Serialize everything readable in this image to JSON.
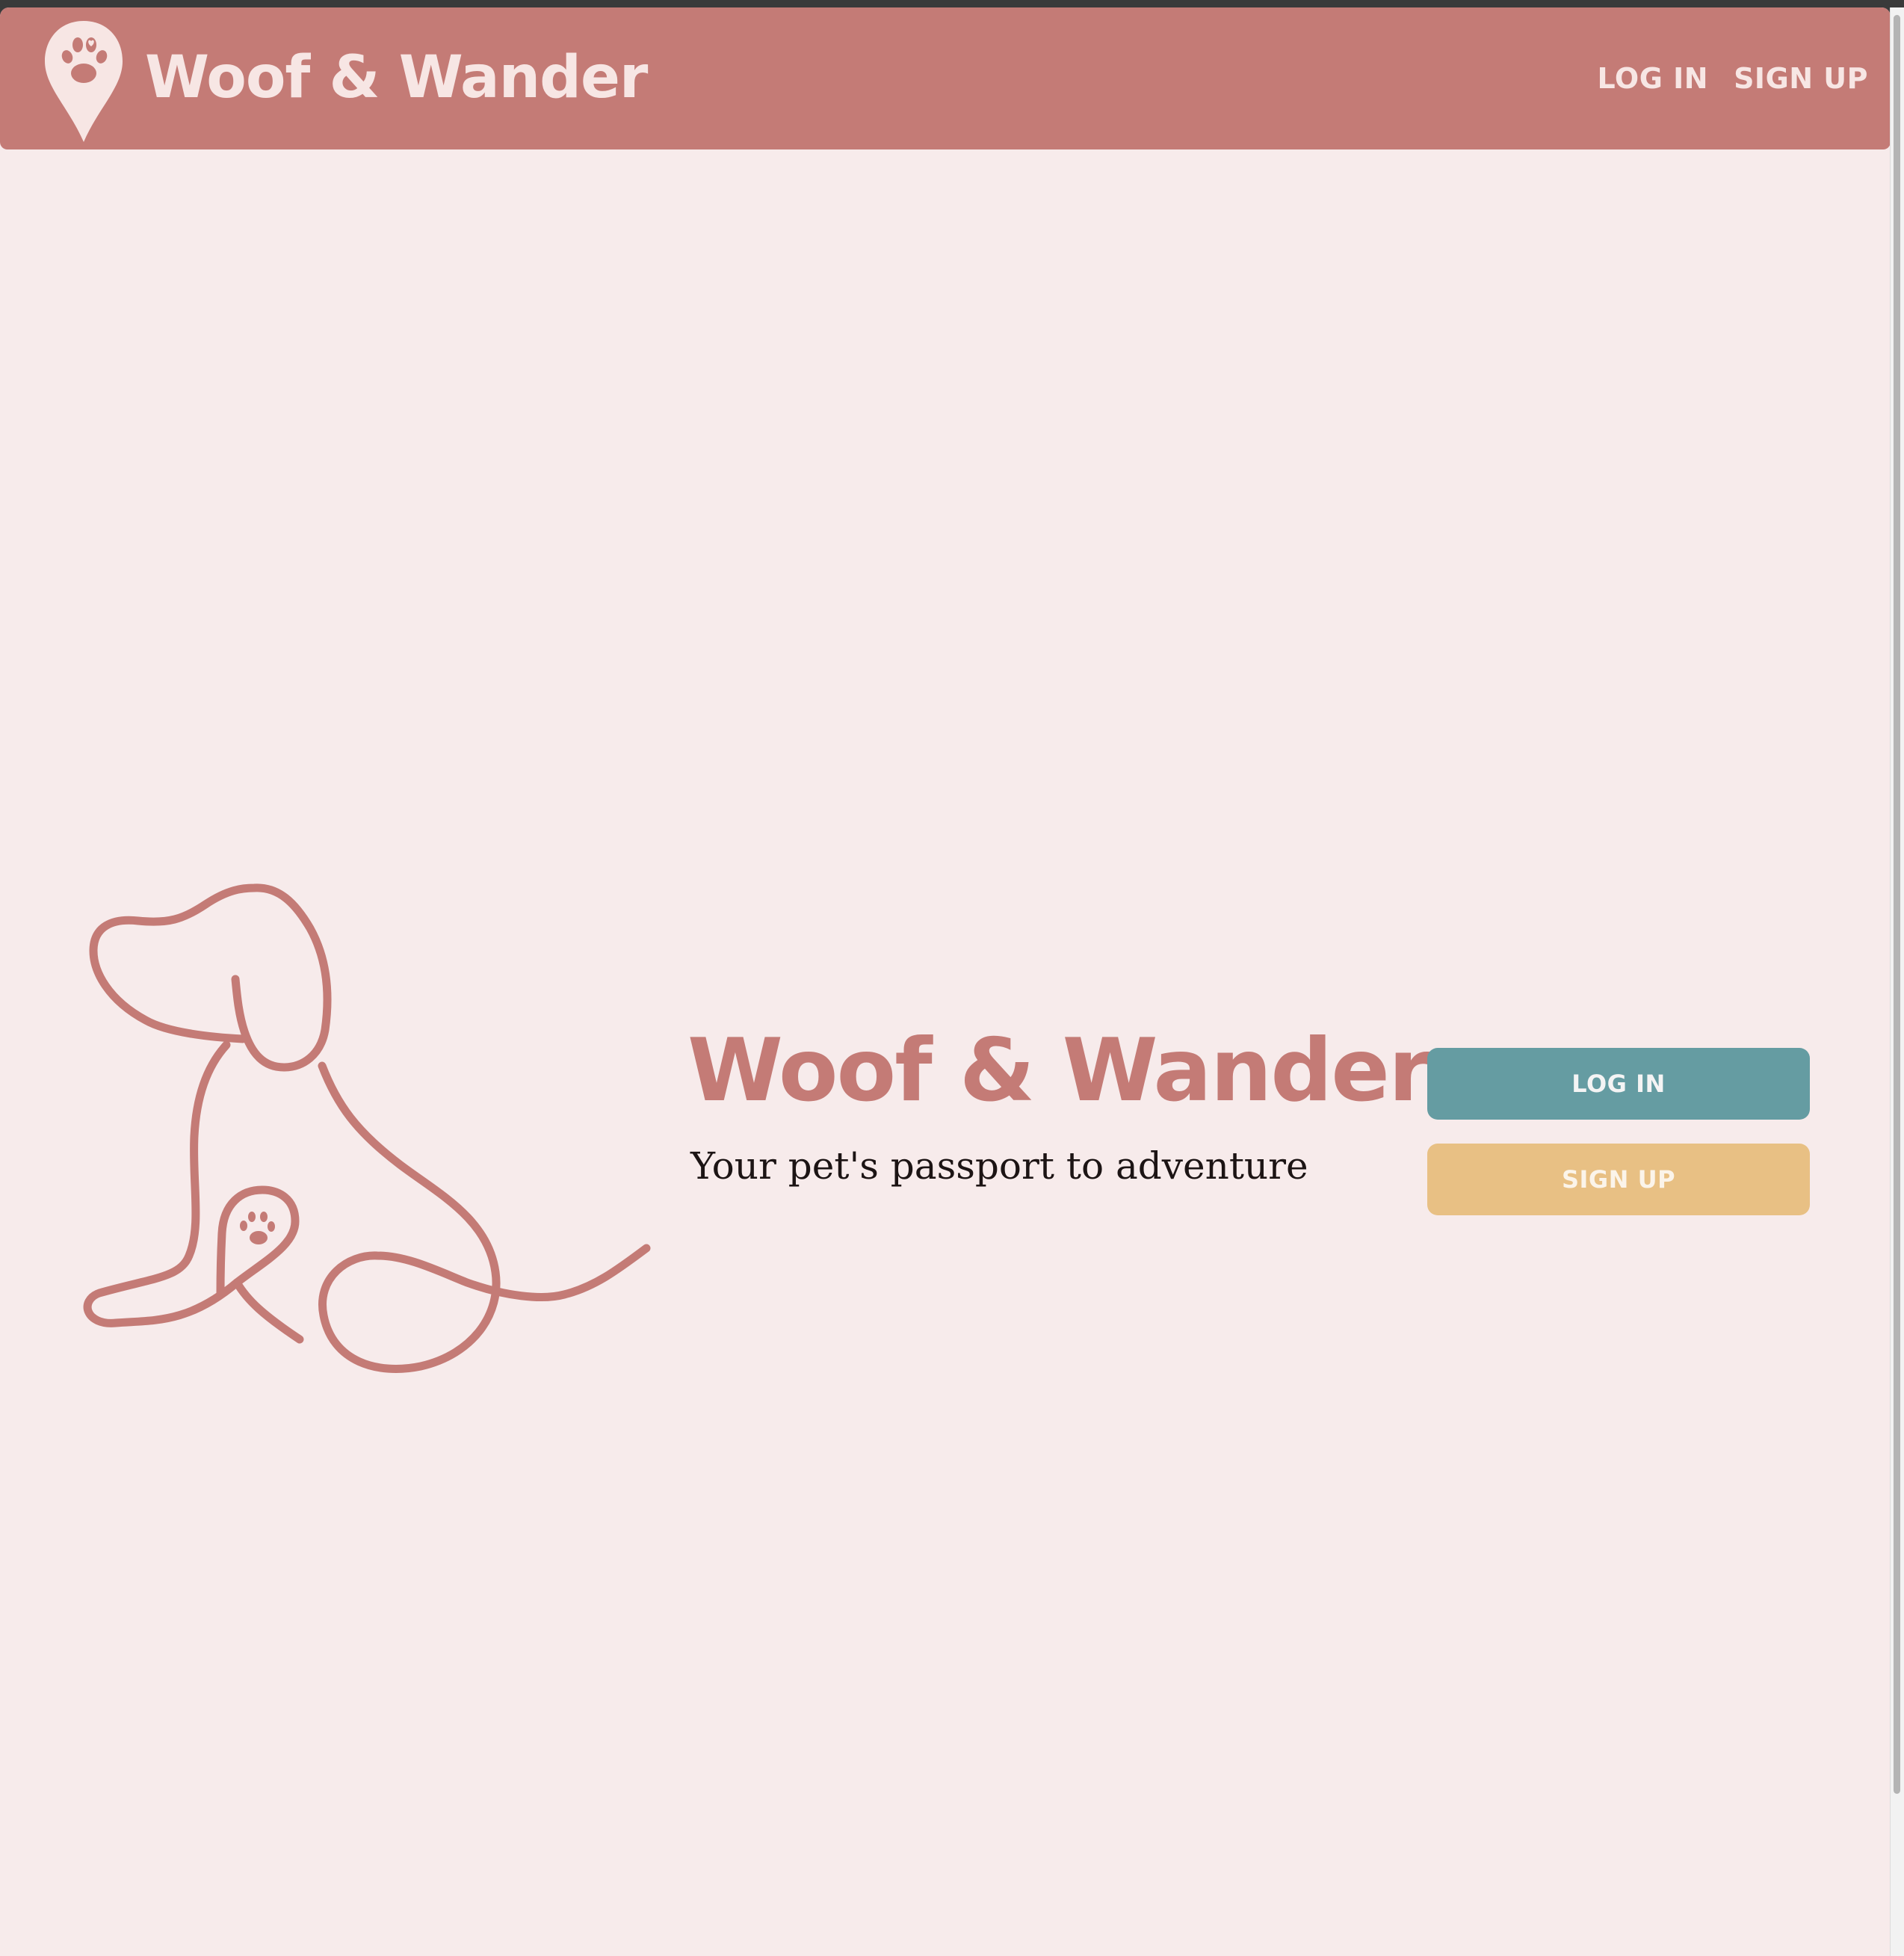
{
  "colors": {
    "primary": "#c47b76",
    "background": "#f7ebeb",
    "teal": "#659ca2",
    "sand": "#e8c084"
  },
  "navbar": {
    "logo_icon": "map-pin-paw-icon",
    "brand_name": "Woof & Wander",
    "links": {
      "login": "LOG IN",
      "signup": "SIGN UP"
    }
  },
  "hero": {
    "illustration": "dog-line-art-icon",
    "title": "Woof & Wander",
    "tagline": "Your pet's passport to adventure",
    "buttons": {
      "login": "LOG IN",
      "signup": "SIGN UP"
    }
  }
}
